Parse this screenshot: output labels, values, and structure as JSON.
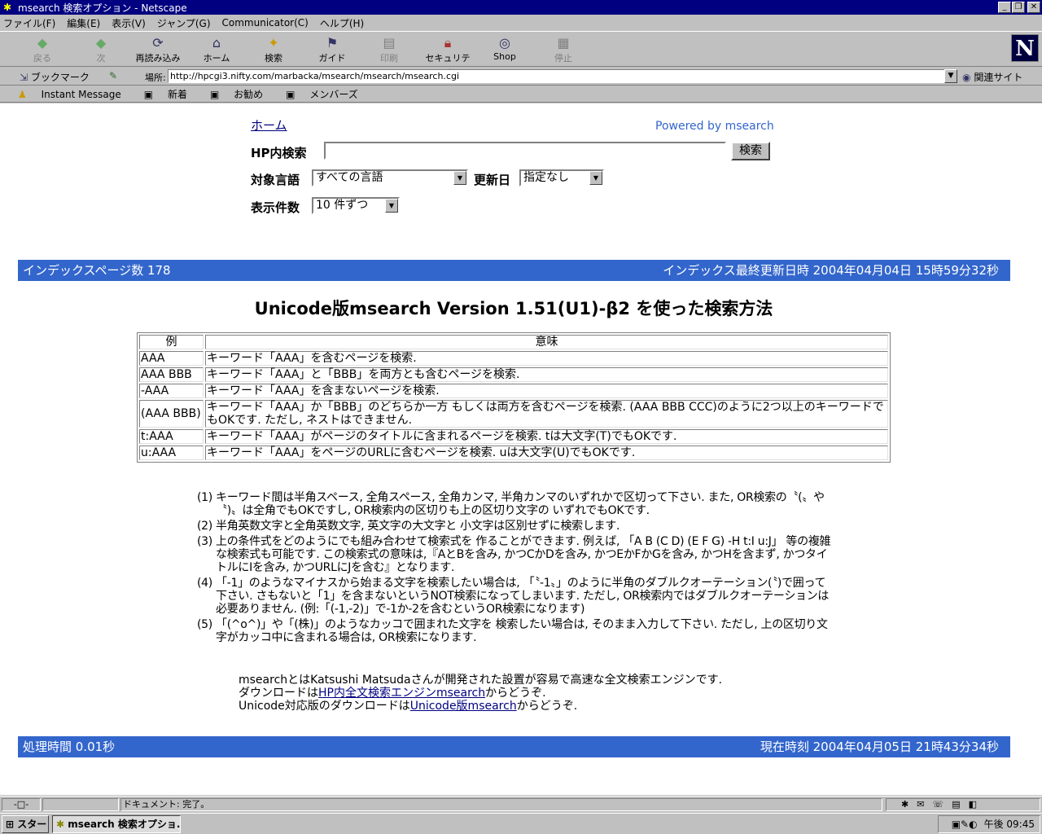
{
  "window": {
    "title": "msearch 検索オプション - Netscape"
  },
  "menu": [
    "ファイル(F)",
    "編集(E)",
    "表示(V)",
    "ジャンプ(G)",
    "Communicator(C)",
    "ヘルプ(H)"
  ],
  "toolbar": [
    {
      "label": "戻る",
      "icon": "back-arrow-icon",
      "disabled": true
    },
    {
      "label": "次",
      "icon": "forward-arrow-icon",
      "disabled": true
    },
    {
      "label": "再読み込み",
      "icon": "reload-icon",
      "disabled": false
    },
    {
      "label": "ホーム",
      "icon": "home-icon",
      "disabled": false
    },
    {
      "label": "検索",
      "icon": "search-icon",
      "disabled": false
    },
    {
      "label": "ガイド",
      "icon": "guide-icon",
      "disabled": false
    },
    {
      "label": "印刷",
      "icon": "print-icon",
      "disabled": true
    },
    {
      "label": "セキュリティ",
      "icon": "lock-icon",
      "disabled": false
    },
    {
      "label": "Shop",
      "icon": "shop-icon",
      "disabled": false
    },
    {
      "label": "停止",
      "icon": "stop-icon",
      "disabled": true
    }
  ],
  "location": {
    "bookmarks": "ブックマーク",
    "label": "場所:",
    "url": "http://hpcgi3.nifty.com/marbacka/msearch/msearch/msearch.cgi",
    "related": "関連サイト"
  },
  "personal": [
    "Instant Message",
    "新着",
    "お勧め",
    "メンバーズ"
  ],
  "form": {
    "home": "ホーム",
    "powered": "Powered by msearch",
    "search_label": "HP内検索",
    "search_button": "検索",
    "lang_label": "対象言語",
    "lang_value": "すべての言語",
    "date_label": "更新日",
    "date_value": "指定なし",
    "count_label": "表示件数",
    "count_value": "10 件ずつ"
  },
  "index_bar": {
    "left": "インデックスページ数 178",
    "right": "インデックス最終更新日時 2004年04月04日 15時59分32秒"
  },
  "heading": "Unicode版msearch Version 1.51(U1)-β2 を使った検索方法",
  "table": {
    "headers": [
      "例",
      "意味"
    ],
    "rows": [
      [
        "AAA",
        "キーワード「AAA」を含むページを検索."
      ],
      [
        "AAA BBB",
        "キーワード「AAA」と「BBB」を両方とも含むページを検索."
      ],
      [
        "-AAA",
        "キーワード「AAA」を含まないページを検索."
      ],
      [
        "(AAA BBB)",
        "キーワード「AAA」か「BBB」のどちらか一方 もしくは両方を含むページを検索. (AAA BBB CCC)のように2つ以上のキーワードでもOKです. ただし, ネストはできません."
      ],
      [
        "t:AAA",
        "キーワード「AAA」がページのタイトルに含まれるページを検索.  tは大文字(T)でもOKです."
      ],
      [
        "u:AAA",
        "キーワード「AAA」をページのURLに含むページを検索.  uは大文字(U)でもOKです."
      ]
    ]
  },
  "notes": [
    {
      "n": "(1)",
      "t": "キーワード間は半角スペース, 全角スペース, 全角カンマ, 半角カンマのいずれかで区切って下さい. また, OR検索の〝(〟や〝)〟は全角でもOKですし, OR検索内の区切りも上の区切り文字の いずれでもOKです."
    },
    {
      "n": "(2)",
      "t": "半角英数文字と全角英数文字, 英文字の大文字と 小文字は区別せずに検索します."
    },
    {
      "n": "(3)",
      "t": "上の条件式をどのようにでも組み合わせて検索式を 作ることができます. 例えば, 「A B (C D) (E F G) -H t:I u:J」 等の複雑な検索式も可能です. この検索式の意味は,『AとBを含み, かつCかDを含み, かつEかFかGを含み, かつHを含まず, かつタイトルにIを含み, かつURLにJを含む』となります."
    },
    {
      "n": "(4)",
      "t": "「-1」のようなマイナスから始まる文字を検索したい場合は, 「〝-1〟」のように半角のダブルクオーテーション(〝)で囲って下さい. さもないと「1」を含まないというNOT検索になってしまいます. ただし, OR検索内ではダブルクオーテーションは必要ありません. (例:「(-1,-2)」で-1か-2を含むというOR検索になります)"
    },
    {
      "n": "(5)",
      "t": "「(^o^)」や「(株)」のようなカッコで囲まれた文字を 検索したい場合は, そのまま入力して下さい. ただし, 上の区切り文字がカッコ中に含まれる場合は, OR検索になります."
    }
  ],
  "credits": {
    "line1": "msearchとはKatsushi Matsudaさんが開発された設置が容易で高速な全文検索エンジンです.",
    "line2_pre": "ダウンロードは",
    "line2_link": "HP内全文検索エンジンmsearch",
    "line2_post": "からどうぞ.",
    "line3_pre": "Unicode対応版のダウンロードは",
    "line3_link": "Unicode版msearch",
    "line3_post": "からどうぞ."
  },
  "footer_bar": {
    "left": "処理時間 0.01秒",
    "right": "現在時刻 2004年04月05日 21時43分34秒"
  },
  "status": {
    "text": "ドキュメント: 完了。"
  },
  "taskbar": {
    "start": "スタート",
    "task": "msearch 検索オプショ...",
    "clock": "午後 09:45"
  }
}
